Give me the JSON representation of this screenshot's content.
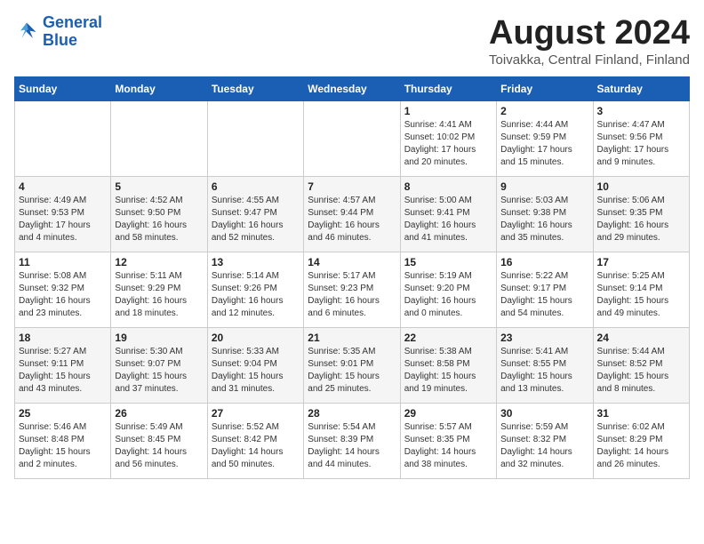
{
  "header": {
    "logo_line1": "General",
    "logo_line2": "Blue",
    "month": "August 2024",
    "location": "Toivakka, Central Finland, Finland"
  },
  "days_of_week": [
    "Sunday",
    "Monday",
    "Tuesday",
    "Wednesday",
    "Thursday",
    "Friday",
    "Saturday"
  ],
  "weeks": [
    [
      {
        "day": "",
        "info": ""
      },
      {
        "day": "",
        "info": ""
      },
      {
        "day": "",
        "info": ""
      },
      {
        "day": "",
        "info": ""
      },
      {
        "day": "1",
        "info": "Sunrise: 4:41 AM\nSunset: 10:02 PM\nDaylight: 17 hours\nand 20 minutes."
      },
      {
        "day": "2",
        "info": "Sunrise: 4:44 AM\nSunset: 9:59 PM\nDaylight: 17 hours\nand 15 minutes."
      },
      {
        "day": "3",
        "info": "Sunrise: 4:47 AM\nSunset: 9:56 PM\nDaylight: 17 hours\nand 9 minutes."
      }
    ],
    [
      {
        "day": "4",
        "info": "Sunrise: 4:49 AM\nSunset: 9:53 PM\nDaylight: 17 hours\nand 4 minutes."
      },
      {
        "day": "5",
        "info": "Sunrise: 4:52 AM\nSunset: 9:50 PM\nDaylight: 16 hours\nand 58 minutes."
      },
      {
        "day": "6",
        "info": "Sunrise: 4:55 AM\nSunset: 9:47 PM\nDaylight: 16 hours\nand 52 minutes."
      },
      {
        "day": "7",
        "info": "Sunrise: 4:57 AM\nSunset: 9:44 PM\nDaylight: 16 hours\nand 46 minutes."
      },
      {
        "day": "8",
        "info": "Sunrise: 5:00 AM\nSunset: 9:41 PM\nDaylight: 16 hours\nand 41 minutes."
      },
      {
        "day": "9",
        "info": "Sunrise: 5:03 AM\nSunset: 9:38 PM\nDaylight: 16 hours\nand 35 minutes."
      },
      {
        "day": "10",
        "info": "Sunrise: 5:06 AM\nSunset: 9:35 PM\nDaylight: 16 hours\nand 29 minutes."
      }
    ],
    [
      {
        "day": "11",
        "info": "Sunrise: 5:08 AM\nSunset: 9:32 PM\nDaylight: 16 hours\nand 23 minutes."
      },
      {
        "day": "12",
        "info": "Sunrise: 5:11 AM\nSunset: 9:29 PM\nDaylight: 16 hours\nand 18 minutes."
      },
      {
        "day": "13",
        "info": "Sunrise: 5:14 AM\nSunset: 9:26 PM\nDaylight: 16 hours\nand 12 minutes."
      },
      {
        "day": "14",
        "info": "Sunrise: 5:17 AM\nSunset: 9:23 PM\nDaylight: 16 hours\nand 6 minutes."
      },
      {
        "day": "15",
        "info": "Sunrise: 5:19 AM\nSunset: 9:20 PM\nDaylight: 16 hours\nand 0 minutes."
      },
      {
        "day": "16",
        "info": "Sunrise: 5:22 AM\nSunset: 9:17 PM\nDaylight: 15 hours\nand 54 minutes."
      },
      {
        "day": "17",
        "info": "Sunrise: 5:25 AM\nSunset: 9:14 PM\nDaylight: 15 hours\nand 49 minutes."
      }
    ],
    [
      {
        "day": "18",
        "info": "Sunrise: 5:27 AM\nSunset: 9:11 PM\nDaylight: 15 hours\nand 43 minutes."
      },
      {
        "day": "19",
        "info": "Sunrise: 5:30 AM\nSunset: 9:07 PM\nDaylight: 15 hours\nand 37 minutes."
      },
      {
        "day": "20",
        "info": "Sunrise: 5:33 AM\nSunset: 9:04 PM\nDaylight: 15 hours\nand 31 minutes."
      },
      {
        "day": "21",
        "info": "Sunrise: 5:35 AM\nSunset: 9:01 PM\nDaylight: 15 hours\nand 25 minutes."
      },
      {
        "day": "22",
        "info": "Sunrise: 5:38 AM\nSunset: 8:58 PM\nDaylight: 15 hours\nand 19 minutes."
      },
      {
        "day": "23",
        "info": "Sunrise: 5:41 AM\nSunset: 8:55 PM\nDaylight: 15 hours\nand 13 minutes."
      },
      {
        "day": "24",
        "info": "Sunrise: 5:44 AM\nSunset: 8:52 PM\nDaylight: 15 hours\nand 8 minutes."
      }
    ],
    [
      {
        "day": "25",
        "info": "Sunrise: 5:46 AM\nSunset: 8:48 PM\nDaylight: 15 hours\nand 2 minutes."
      },
      {
        "day": "26",
        "info": "Sunrise: 5:49 AM\nSunset: 8:45 PM\nDaylight: 14 hours\nand 56 minutes."
      },
      {
        "day": "27",
        "info": "Sunrise: 5:52 AM\nSunset: 8:42 PM\nDaylight: 14 hours\nand 50 minutes."
      },
      {
        "day": "28",
        "info": "Sunrise: 5:54 AM\nSunset: 8:39 PM\nDaylight: 14 hours\nand 44 minutes."
      },
      {
        "day": "29",
        "info": "Sunrise: 5:57 AM\nSunset: 8:35 PM\nDaylight: 14 hours\nand 38 minutes."
      },
      {
        "day": "30",
        "info": "Sunrise: 5:59 AM\nSunset: 8:32 PM\nDaylight: 14 hours\nand 32 minutes."
      },
      {
        "day": "31",
        "info": "Sunrise: 6:02 AM\nSunset: 8:29 PM\nDaylight: 14 hours\nand 26 minutes."
      }
    ]
  ]
}
